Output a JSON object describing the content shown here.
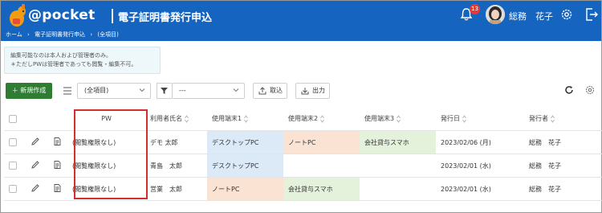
{
  "header": {
    "logo_text": "@pocket",
    "logo_sub": "@pocket",
    "app_title": "電子証明書発行申込",
    "notification_count": "13",
    "user_name": "総務　花子"
  },
  "breadcrumb": [
    "ホーム",
    "›",
    "電子証明書発行申込",
    "›",
    "(全項目)"
  ],
  "notice": {
    "line1": "編集可能なのは本人および管理者のみ。",
    "line2": "＊ただしPWは管理者であっても閲覧・編集不可。"
  },
  "toolbar": {
    "new_label": "＋ 新規作成",
    "view_select": "(全項目)",
    "filter_select": "---",
    "import_label": "取込",
    "export_label": "出力"
  },
  "table": {
    "columns": [
      "PW",
      "利用者氏名",
      "使用端末1",
      "使用端末2",
      "使用端末3",
      "発行日",
      "発行者"
    ],
    "rows": [
      {
        "pw": "(閲覧権限なし)",
        "user": "デモ 太郎",
        "t1": "デスクトップPC",
        "t2": "ノートPC",
        "t3": "会社貸与スマホ",
        "date": "2023/02/06 (月)",
        "issuer": "総務　花子"
      },
      {
        "pw": "(閲覧権限なし)",
        "user": "青島　太郎",
        "t1": "デスクトップPC",
        "t2": "",
        "t3": "",
        "date": "2023/02/01 (水)",
        "issuer": "総務　花子"
      },
      {
        "pw": "(閲覧権限なし)",
        "user": "営業　太郎",
        "t1": "ノートPC",
        "t2": "会社貸与スマホ",
        "t3": "",
        "date": "2023/02/01 (水)",
        "issuer": "総務　花子"
      }
    ]
  },
  "colors": {
    "header_bg": "#1565c0",
    "new_button": "#2e7d32",
    "desktop_pc": "#dce9f7",
    "notebook_pc": "#fbe3d4",
    "phone": "#e4f2dc",
    "highlight": "#d32f2f"
  }
}
